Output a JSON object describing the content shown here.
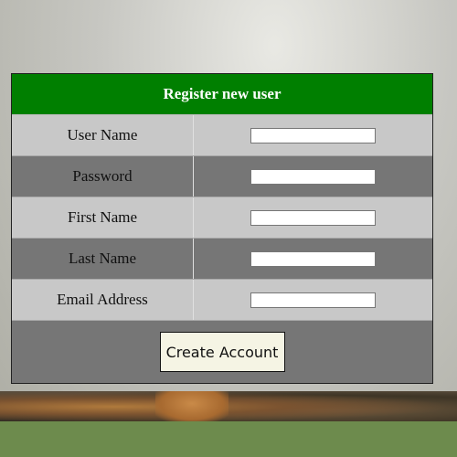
{
  "form": {
    "title": "Register new user",
    "fields": [
      {
        "label": "User Name",
        "value": "",
        "placeholder": ""
      },
      {
        "label": "Password",
        "value": "",
        "placeholder": ""
      },
      {
        "label": "First Name",
        "value": "",
        "placeholder": ""
      },
      {
        "label": "Last Name",
        "value": "",
        "placeholder": ""
      },
      {
        "label": "Email Address",
        "value": "",
        "placeholder": ""
      }
    ],
    "submit_label": "Create Account"
  },
  "colors": {
    "header": "#007f00",
    "row_light": "#c8c8c8",
    "row_dark": "#767676",
    "button": "#f5f4e4",
    "footer": "#6d8b4d"
  }
}
